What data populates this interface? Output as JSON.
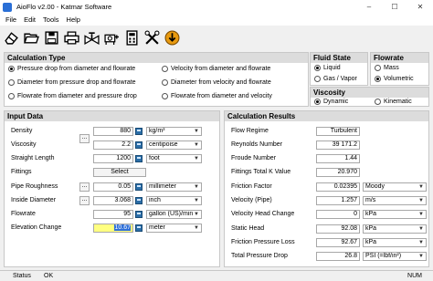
{
  "window": {
    "title": "AioFlo  v2.00 - Katmar Software",
    "minimize": "–",
    "maximize": "☐",
    "close": "✕"
  },
  "menu": [
    "File",
    "Edit",
    "Tools",
    "Help"
  ],
  "toolbar": [
    "eraser-icon",
    "open-folder-icon",
    "save-disk-icon",
    "print-icon",
    "valve-icon",
    "pump-icon",
    "calculator-icon",
    "tools-icon",
    "download-icon"
  ],
  "calculation_type": {
    "title": "Calculation Type",
    "options": [
      "Pressure drop from diameter and flowrate",
      "Velocity from diameter and flowrate",
      "Diameter from pressure drop and flowrate",
      "Diameter from velocity and flowrate",
      "Flowrate from diameter and pressure drop",
      "Flowrate from diameter and velocity"
    ],
    "selected": 0
  },
  "fluid_state": {
    "title": "Fluid State",
    "options": [
      "Liquid",
      "Gas / Vapor"
    ],
    "selected": 0
  },
  "flowrate_type": {
    "title": "Flowrate",
    "options": [
      "Mass",
      "Volumetric"
    ],
    "selected": 1
  },
  "viscosity_type": {
    "title": "Viscosity",
    "options": [
      "Dynamic",
      "Kinematic"
    ],
    "selected": 0
  },
  "input_data": {
    "title": "Input Data",
    "density": {
      "label": "Density",
      "value": "880",
      "unit": "kg/m³"
    },
    "viscosity": {
      "label": "Viscosity",
      "value": "2.2",
      "unit": "centipoise"
    },
    "straight_length": {
      "label": "Straight Length",
      "value": "1200",
      "unit": "foot"
    },
    "fittings": {
      "label": "Fittings",
      "button": "Select"
    },
    "pipe_roughness": {
      "label": "Pipe Roughness",
      "value": "0.05",
      "unit": "millimeter"
    },
    "inside_diameter": {
      "label": "Inside Diameter",
      "value": "3.068",
      "unit": "inch"
    },
    "flowrate": {
      "label": "Flowrate",
      "value": "95",
      "unit": "gallon (US)/min"
    },
    "elevation_change": {
      "label": "Elevation Change",
      "value": "10.67",
      "unit": "meter"
    },
    "dots": "..."
  },
  "results": {
    "title": "Calculation Results",
    "flow_regime": {
      "label": "Flow Regime",
      "value": "Turbulent"
    },
    "reynolds": {
      "label": "Reynolds Number",
      "value": "39 171.2"
    },
    "froude": {
      "label": "Froude Number",
      "value": "1.44"
    },
    "fittings_k": {
      "label": "Fittings Total K Value",
      "value": "20.970"
    },
    "friction_factor": {
      "label": "Friction Factor",
      "value": "0.02395",
      "unit": "Moody"
    },
    "velocity_pipe": {
      "label": "Velocity (Pipe)",
      "value": "1.257",
      "unit": "m/s"
    },
    "velocity_head_change": {
      "label": "Velocity Head Change",
      "value": "0",
      "unit": "kPa"
    },
    "static_head": {
      "label": "Static Head",
      "value": "92.08",
      "unit": "kPa"
    },
    "friction_pressure_loss": {
      "label": "Friction Pressure Loss",
      "value": "92.67",
      "unit": "kPa"
    },
    "total_pressure_drop": {
      "label": "Total Pressure Drop",
      "value": "26.8",
      "unit": "PSI (=lbf/in²)"
    }
  },
  "status": {
    "label": "Status",
    "text": "OK",
    "num": "NUM"
  }
}
